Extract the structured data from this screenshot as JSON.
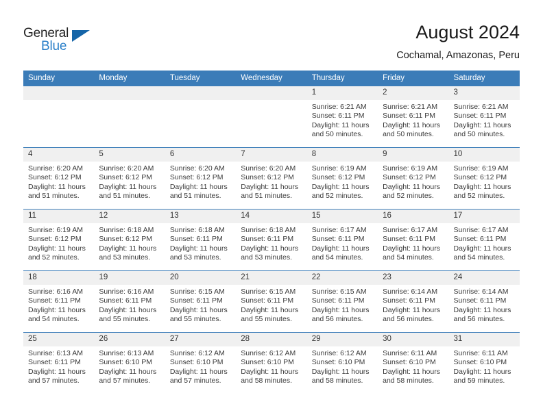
{
  "brand": {
    "name_part1": "General",
    "name_part2": "Blue",
    "accent_color": "#2a7fc9",
    "triangle_color": "#1565a8"
  },
  "header": {
    "title": "August 2024",
    "subtitle": "Cochamal, Amazonas, Peru"
  },
  "theme": {
    "header_blue": "#3b7cb8",
    "daynum_bg": "#f0f0f0"
  },
  "weekday_headers": [
    "Sunday",
    "Monday",
    "Tuesday",
    "Wednesday",
    "Thursday",
    "Friday",
    "Saturday"
  ],
  "weeks": [
    [
      {
        "day": "",
        "empty": true,
        "sunrise": "",
        "sunset": "",
        "daylight1": "",
        "daylight2": ""
      },
      {
        "day": "",
        "empty": true,
        "sunrise": "",
        "sunset": "",
        "daylight1": "",
        "daylight2": ""
      },
      {
        "day": "",
        "empty": true,
        "sunrise": "",
        "sunset": "",
        "daylight1": "",
        "daylight2": ""
      },
      {
        "day": "",
        "empty": true,
        "sunrise": "",
        "sunset": "",
        "daylight1": "",
        "daylight2": ""
      },
      {
        "day": "1",
        "empty": false,
        "sunrise": "Sunrise: 6:21 AM",
        "sunset": "Sunset: 6:11 PM",
        "daylight1": "Daylight: 11 hours",
        "daylight2": "and 50 minutes."
      },
      {
        "day": "2",
        "empty": false,
        "sunrise": "Sunrise: 6:21 AM",
        "sunset": "Sunset: 6:11 PM",
        "daylight1": "Daylight: 11 hours",
        "daylight2": "and 50 minutes."
      },
      {
        "day": "3",
        "empty": false,
        "sunrise": "Sunrise: 6:21 AM",
        "sunset": "Sunset: 6:11 PM",
        "daylight1": "Daylight: 11 hours",
        "daylight2": "and 50 minutes."
      }
    ],
    [
      {
        "day": "4",
        "empty": false,
        "sunrise": "Sunrise: 6:20 AM",
        "sunset": "Sunset: 6:12 PM",
        "daylight1": "Daylight: 11 hours",
        "daylight2": "and 51 minutes."
      },
      {
        "day": "5",
        "empty": false,
        "sunrise": "Sunrise: 6:20 AM",
        "sunset": "Sunset: 6:12 PM",
        "daylight1": "Daylight: 11 hours",
        "daylight2": "and 51 minutes."
      },
      {
        "day": "6",
        "empty": false,
        "sunrise": "Sunrise: 6:20 AM",
        "sunset": "Sunset: 6:12 PM",
        "daylight1": "Daylight: 11 hours",
        "daylight2": "and 51 minutes."
      },
      {
        "day": "7",
        "empty": false,
        "sunrise": "Sunrise: 6:20 AM",
        "sunset": "Sunset: 6:12 PM",
        "daylight1": "Daylight: 11 hours",
        "daylight2": "and 51 minutes."
      },
      {
        "day": "8",
        "empty": false,
        "sunrise": "Sunrise: 6:19 AM",
        "sunset": "Sunset: 6:12 PM",
        "daylight1": "Daylight: 11 hours",
        "daylight2": "and 52 minutes."
      },
      {
        "day": "9",
        "empty": false,
        "sunrise": "Sunrise: 6:19 AM",
        "sunset": "Sunset: 6:12 PM",
        "daylight1": "Daylight: 11 hours",
        "daylight2": "and 52 minutes."
      },
      {
        "day": "10",
        "empty": false,
        "sunrise": "Sunrise: 6:19 AM",
        "sunset": "Sunset: 6:12 PM",
        "daylight1": "Daylight: 11 hours",
        "daylight2": "and 52 minutes."
      }
    ],
    [
      {
        "day": "11",
        "empty": false,
        "sunrise": "Sunrise: 6:19 AM",
        "sunset": "Sunset: 6:12 PM",
        "daylight1": "Daylight: 11 hours",
        "daylight2": "and 52 minutes."
      },
      {
        "day": "12",
        "empty": false,
        "sunrise": "Sunrise: 6:18 AM",
        "sunset": "Sunset: 6:12 PM",
        "daylight1": "Daylight: 11 hours",
        "daylight2": "and 53 minutes."
      },
      {
        "day": "13",
        "empty": false,
        "sunrise": "Sunrise: 6:18 AM",
        "sunset": "Sunset: 6:11 PM",
        "daylight1": "Daylight: 11 hours",
        "daylight2": "and 53 minutes."
      },
      {
        "day": "14",
        "empty": false,
        "sunrise": "Sunrise: 6:18 AM",
        "sunset": "Sunset: 6:11 PM",
        "daylight1": "Daylight: 11 hours",
        "daylight2": "and 53 minutes."
      },
      {
        "day": "15",
        "empty": false,
        "sunrise": "Sunrise: 6:17 AM",
        "sunset": "Sunset: 6:11 PM",
        "daylight1": "Daylight: 11 hours",
        "daylight2": "and 54 minutes."
      },
      {
        "day": "16",
        "empty": false,
        "sunrise": "Sunrise: 6:17 AM",
        "sunset": "Sunset: 6:11 PM",
        "daylight1": "Daylight: 11 hours",
        "daylight2": "and 54 minutes."
      },
      {
        "day": "17",
        "empty": false,
        "sunrise": "Sunrise: 6:17 AM",
        "sunset": "Sunset: 6:11 PM",
        "daylight1": "Daylight: 11 hours",
        "daylight2": "and 54 minutes."
      }
    ],
    [
      {
        "day": "18",
        "empty": false,
        "sunrise": "Sunrise: 6:16 AM",
        "sunset": "Sunset: 6:11 PM",
        "daylight1": "Daylight: 11 hours",
        "daylight2": "and 54 minutes."
      },
      {
        "day": "19",
        "empty": false,
        "sunrise": "Sunrise: 6:16 AM",
        "sunset": "Sunset: 6:11 PM",
        "daylight1": "Daylight: 11 hours",
        "daylight2": "and 55 minutes."
      },
      {
        "day": "20",
        "empty": false,
        "sunrise": "Sunrise: 6:15 AM",
        "sunset": "Sunset: 6:11 PM",
        "daylight1": "Daylight: 11 hours",
        "daylight2": "and 55 minutes."
      },
      {
        "day": "21",
        "empty": false,
        "sunrise": "Sunrise: 6:15 AM",
        "sunset": "Sunset: 6:11 PM",
        "daylight1": "Daylight: 11 hours",
        "daylight2": "and 55 minutes."
      },
      {
        "day": "22",
        "empty": false,
        "sunrise": "Sunrise: 6:15 AM",
        "sunset": "Sunset: 6:11 PM",
        "daylight1": "Daylight: 11 hours",
        "daylight2": "and 56 minutes."
      },
      {
        "day": "23",
        "empty": false,
        "sunrise": "Sunrise: 6:14 AM",
        "sunset": "Sunset: 6:11 PM",
        "daylight1": "Daylight: 11 hours",
        "daylight2": "and 56 minutes."
      },
      {
        "day": "24",
        "empty": false,
        "sunrise": "Sunrise: 6:14 AM",
        "sunset": "Sunset: 6:11 PM",
        "daylight1": "Daylight: 11 hours",
        "daylight2": "and 56 minutes."
      }
    ],
    [
      {
        "day": "25",
        "empty": false,
        "sunrise": "Sunrise: 6:13 AM",
        "sunset": "Sunset: 6:11 PM",
        "daylight1": "Daylight: 11 hours",
        "daylight2": "and 57 minutes."
      },
      {
        "day": "26",
        "empty": false,
        "sunrise": "Sunrise: 6:13 AM",
        "sunset": "Sunset: 6:10 PM",
        "daylight1": "Daylight: 11 hours",
        "daylight2": "and 57 minutes."
      },
      {
        "day": "27",
        "empty": false,
        "sunrise": "Sunrise: 6:12 AM",
        "sunset": "Sunset: 6:10 PM",
        "daylight1": "Daylight: 11 hours",
        "daylight2": "and 57 minutes."
      },
      {
        "day": "28",
        "empty": false,
        "sunrise": "Sunrise: 6:12 AM",
        "sunset": "Sunset: 6:10 PM",
        "daylight1": "Daylight: 11 hours",
        "daylight2": "and 58 minutes."
      },
      {
        "day": "29",
        "empty": false,
        "sunrise": "Sunrise: 6:12 AM",
        "sunset": "Sunset: 6:10 PM",
        "daylight1": "Daylight: 11 hours",
        "daylight2": "and 58 minutes."
      },
      {
        "day": "30",
        "empty": false,
        "sunrise": "Sunrise: 6:11 AM",
        "sunset": "Sunset: 6:10 PM",
        "daylight1": "Daylight: 11 hours",
        "daylight2": "and 58 minutes."
      },
      {
        "day": "31",
        "empty": false,
        "sunrise": "Sunrise: 6:11 AM",
        "sunset": "Sunset: 6:10 PM",
        "daylight1": "Daylight: 11 hours",
        "daylight2": "and 59 minutes."
      }
    ]
  ]
}
